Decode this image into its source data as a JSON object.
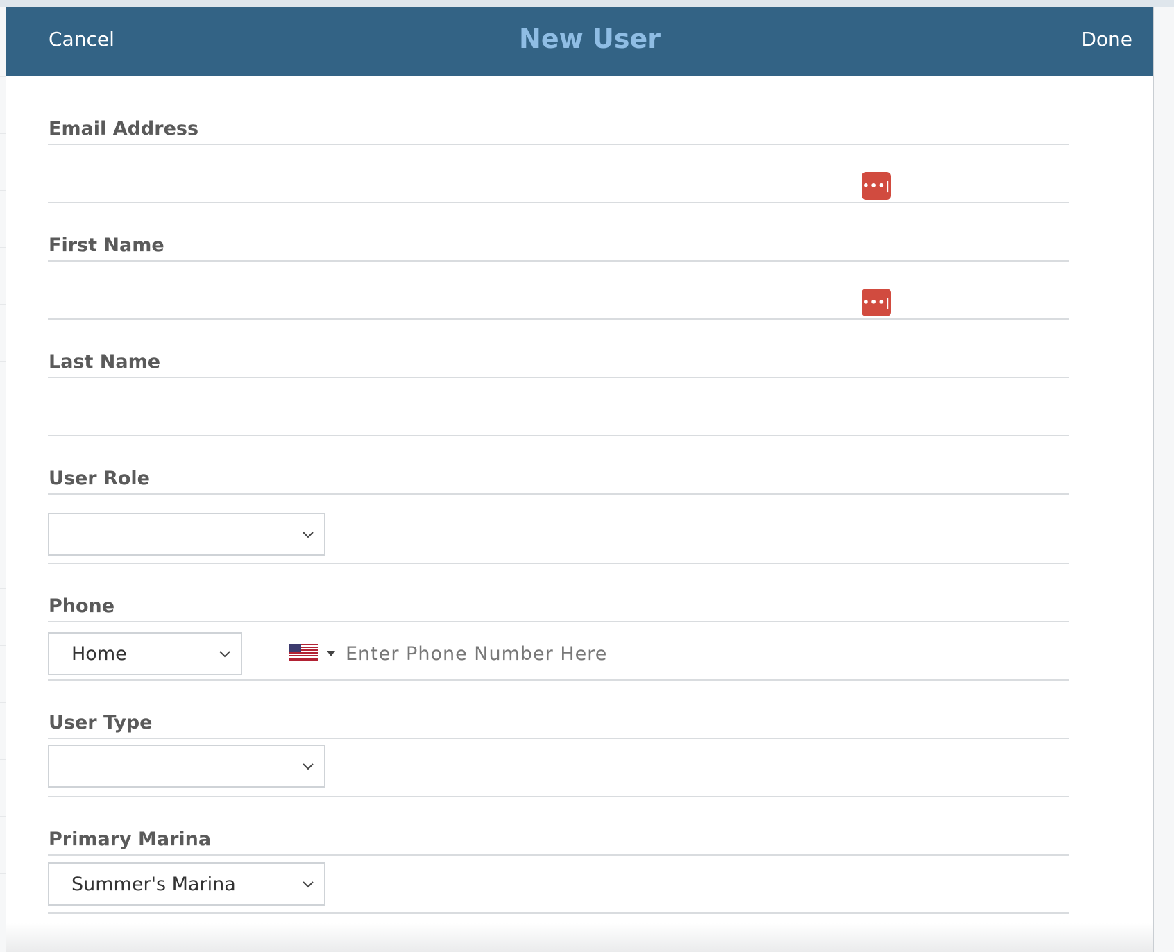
{
  "header": {
    "cancel_label": "Cancel",
    "title": "New User",
    "done_label": "Done"
  },
  "form": {
    "email_label": "Email Address",
    "first_name_label": "First Name",
    "last_name_label": "Last Name",
    "user_role_label": "User Role",
    "user_role_value": "",
    "phone_label": "Phone",
    "phone_type_value": "Home",
    "phone_placeholder": "Enter Phone Number Here",
    "phone_country_icon": "us-flag-icon",
    "user_type_label": "User Type",
    "user_type_value": "",
    "primary_marina_label": "Primary Marina",
    "primary_marina_value": "Summer's Marina"
  },
  "icons": {
    "password_manager": "password-manager-icon",
    "password_manager_glyph": "•••|",
    "dropdown": "chevron-down-icon"
  },
  "colors": {
    "header_bg": "#336385",
    "title": "#8fbde4",
    "password_manager": "#d14b3f"
  }
}
